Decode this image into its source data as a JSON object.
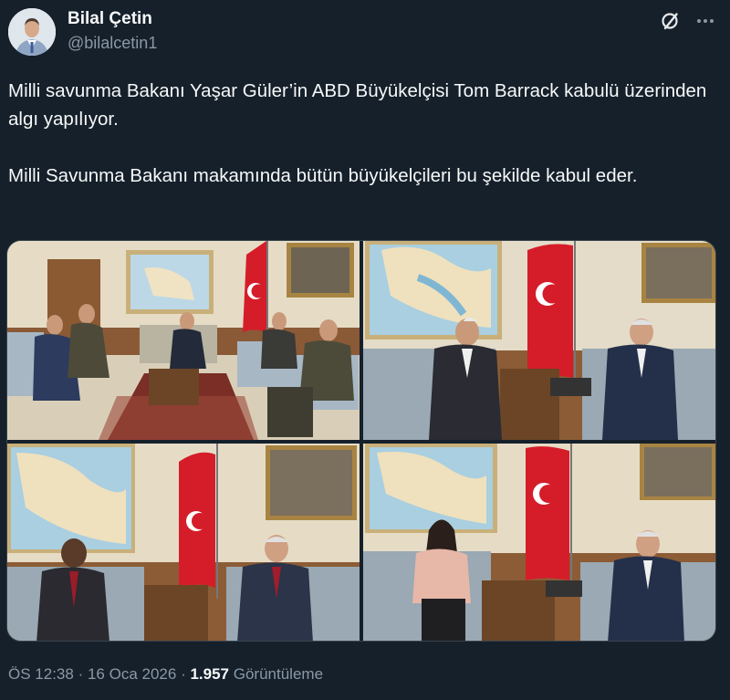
{
  "author": {
    "display_name": "Bilal Çetin",
    "handle": "@bilalcetin1"
  },
  "header_icons": [
    "grok-icon",
    "more-icon"
  ],
  "tweet": {
    "paragraph_1": "Milli savunma Bakanı Yaşar Güler’in ABD Büyükelçisi Tom Barrack kabulü üzerinden algı yapılıyor.",
    "paragraph_2": "Milli Savunma Bakanı makamında bütün büyükelçileri bu şekilde kabul eder."
  },
  "media": {
    "photo_count": 4
  },
  "meta": {
    "time": "ÖS 12:38",
    "separator": "·",
    "date": "16 Oca 2026",
    "views_count": "1.957",
    "views_label": "Görüntüleme"
  },
  "colors": {
    "background": "#15202b",
    "text_primary": "#f7f9f9",
    "text_secondary": "#8b98a5",
    "border": "#38444d"
  }
}
